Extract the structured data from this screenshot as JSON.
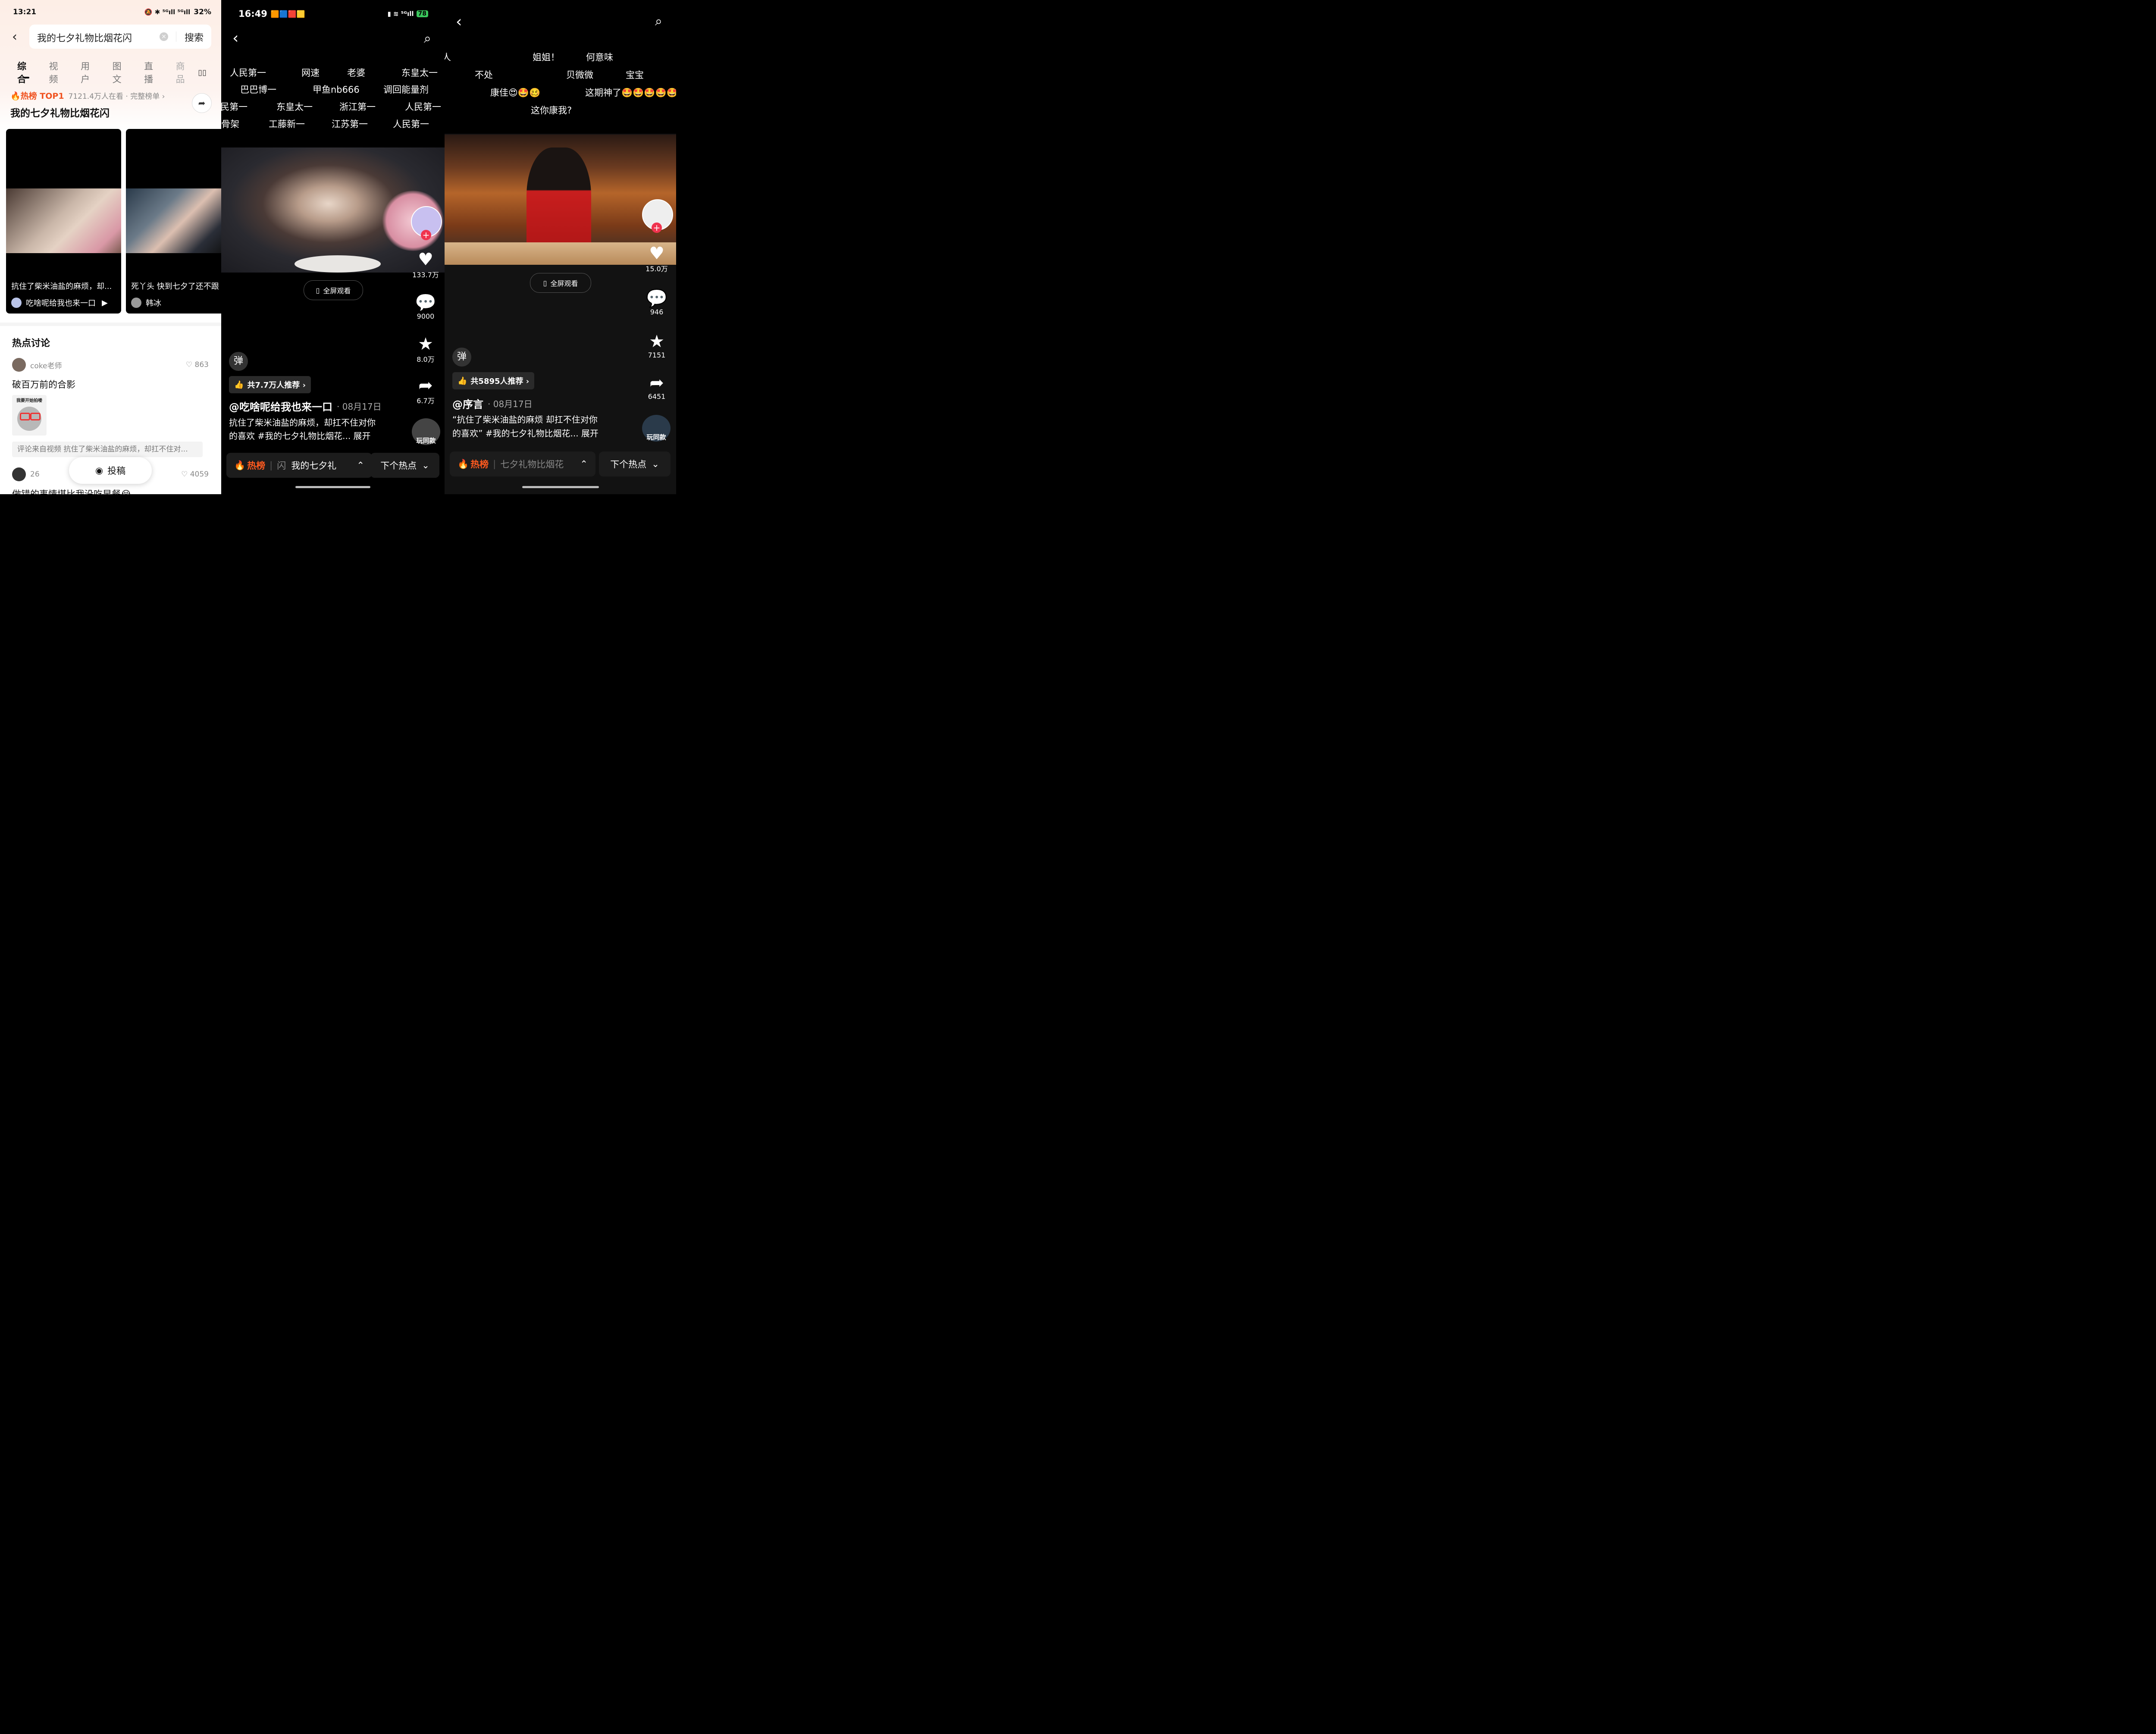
{
  "panel1": {
    "status": {
      "time": "13:21",
      "icons": "🔕 ✱ ⁵ᴳıll ⁵ᴳıll",
      "battery": "32%"
    },
    "search": {
      "query": "我的七夕礼物比烟花闪",
      "button": "搜索"
    },
    "tabs": [
      "综合",
      "视频",
      "用户",
      "图文",
      "直播",
      "商品"
    ],
    "hot": {
      "badge": "热榜 TOP1",
      "viewers": "7121.4万人在看 · 完整榜单 ›",
      "title": "我的七夕礼物比烟花闪"
    },
    "cards": [
      {
        "title": "抗住了柴米油盐的麻烦，却...",
        "author": "吃啥呢给我也来一口"
      },
      {
        "title": "死丫头 快到七夕了还不跟",
        "author": "韩冰"
      }
    ],
    "discussion": {
      "heading": "热点讨论",
      "items": [
        {
          "user": "coke老师",
          "likes": "863",
          "text": "破百万前的合影",
          "sticker_caption": "我要开始拍喽",
          "source": "评论来自视频 抗住了柴米油盐的麻烦，却扛不住对..."
        },
        {
          "user": "26",
          "likes": "4059",
          "text": "做错的事情堪比我没吃早餐😭"
        }
      ],
      "post_button": "投稿"
    }
  },
  "panel2": {
    "status": {
      "time": "16:49",
      "battery": "78"
    },
    "danmaku": [
      "人民第一",
      "网速",
      "老婆",
      "东皇太一",
      "巴巴博一",
      "甲鱼nb666",
      "调回能量剂",
      "民第一",
      "东皇太一",
      "浙江第一",
      "人民第一",
      "骨架",
      "工藤新一",
      "江苏第一",
      "人民第一"
    ],
    "likes": "133.7万",
    "comments": "9000",
    "favorites": "8.0万",
    "shares": "6.7万",
    "fullscreen": "全屏观看",
    "danmu_toggle": "弹",
    "recommend": "共7.7万人推荐 ›",
    "author": "@吃啥呢给我也来一口",
    "date": "· 08月17日",
    "caption_l1": "抗住了柴米油盐的麻烦，却扛不住对你",
    "caption_l2": "的喜欢 #我的七夕礼物比烟花... 展开",
    "play_same": "玩同款",
    "hot_label": "热榜",
    "hot_sep": "闪",
    "hot_topic": "我的七夕礼",
    "next_hot": "下个热点"
  },
  "panel3": {
    "danmaku": [
      "人",
      "姐姐！",
      "何意味",
      "不处",
      "贝微微",
      "宝宝",
      "康佳😍🤩🥴",
      "这期神了🤩🤩🤩🤩🤩",
      "这你康我?"
    ],
    "likes": "15.0万",
    "comments": "946",
    "favorites": "7151",
    "shares": "6451",
    "fullscreen": "全屏观看",
    "danmu_toggle": "弹",
    "recommend": "共5895人推荐 ›",
    "author": "@序言",
    "date": "· 08月17日",
    "caption_l1": "“抗住了柴米油盐的麻烦 却扛不住对你",
    "caption_l2": "的喜欢” #我的七夕礼物比烟花... 展开",
    "play_same": "玩同款",
    "hot_label": "热榜",
    "hot_topic": "七夕礼物比烟花",
    "next_hot": "下个热点"
  }
}
